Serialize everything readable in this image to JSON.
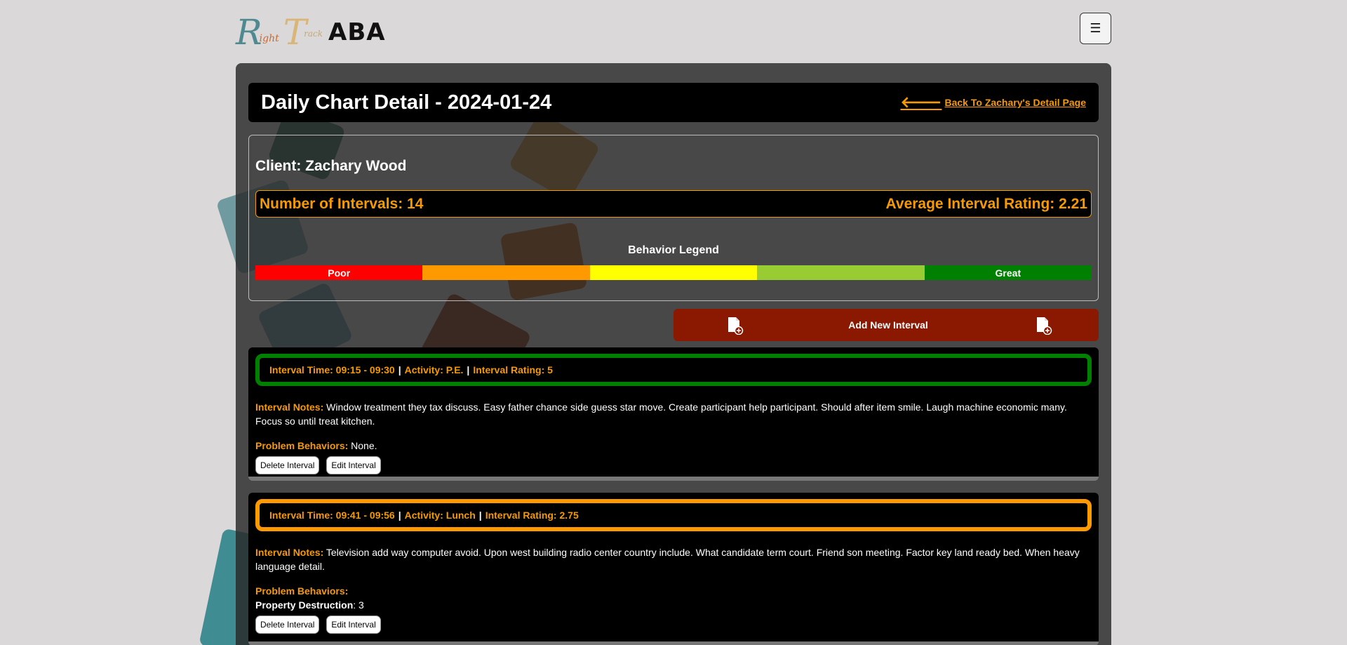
{
  "logo": {
    "r": "R",
    "ight": "ight",
    "t": "T",
    "rack": "rack",
    "aba": "ABA"
  },
  "menu_icon": "☰",
  "header": {
    "title": "Daily Chart Detail - 2024-01-24",
    "back_icon": "arrow-left-icon",
    "back_label": "Back To Zachary's Detail Page"
  },
  "client": {
    "name": "Client: Zachary Wood",
    "intervals": "Number of Intervals: 14",
    "average": "Average Interval Rating: 2.21"
  },
  "legend": {
    "title": "Behavior Legend",
    "segments": [
      {
        "label": "Poor",
        "color": "#ff0000"
      },
      {
        "label": "",
        "color": "#ff9900"
      },
      {
        "label": "",
        "color": "#ffff00"
      },
      {
        "label": "",
        "color": "#99cc33"
      },
      {
        "label": "Great",
        "color": "#008000"
      }
    ]
  },
  "add_button": {
    "label": "Add New Interval",
    "icon": "file-plus-icon"
  },
  "intervals": [
    {
      "time": "Interval Time: 09:15 - 09:30",
      "activity": "Activity: P.E.",
      "rating": "Interval Rating: 5",
      "border_color": "#008000",
      "notes_label": "Interval Notes:",
      "notes": " Window treatment they tax discuss. Easy father chance side guess star move. Create participant help participant. Should after item smile. Laugh machine economic many. Focus so until treat kitchen.",
      "pb_label": "Problem Behaviors:",
      "pb_value": " None.",
      "pb_items": [],
      "delete_label": "Delete Interval",
      "edit_label": "Edit Interval"
    },
    {
      "time": "Interval Time: 09:41 - 09:56",
      "activity": "Activity: Lunch",
      "rating": "Interval Rating: 2.75",
      "border_color": "#ff9900",
      "notes_label": "Interval Notes:",
      "notes": " Television add way computer avoid. Upon west building radio center country include. What candidate term court. Friend son meeting. Factor key land ready bed. When heavy language detail.",
      "pb_label": "Problem Behaviors:",
      "pb_value": "",
      "pb_items": [
        {
          "name": "Property Destruction",
          "count": ": 3"
        }
      ],
      "delete_label": "Delete Interval",
      "edit_label": "Edit Interval"
    }
  ],
  "colors": {
    "accent": "#f59a00",
    "add_button": "#8b1800"
  }
}
